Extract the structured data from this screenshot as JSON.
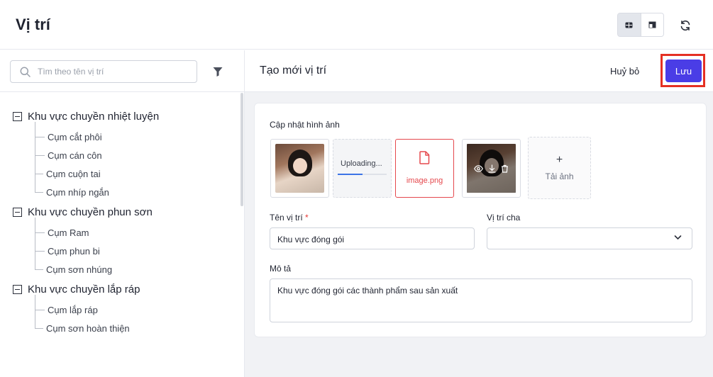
{
  "header": {
    "title": "Vị trí"
  },
  "sidebar": {
    "search_placeholder": "Tìm theo tên vị trí",
    "groups": [
      {
        "label": "Khu vực chuyền nhiệt luyện",
        "items": [
          "Cụm cắt phôi",
          "Cụm cán côn",
          "Cụm cuộn tai",
          "Cụm nhíp ngắn"
        ]
      },
      {
        "label": "Khu vực chuyền phun sơn",
        "items": [
          "Cụm Ram",
          "Cụm phun bi",
          "Cụm sơn nhúng"
        ]
      },
      {
        "label": "Khu vực chuyền lắp ráp",
        "items": [
          "Cụm lắp ráp",
          "Cụm sơn hoàn thiện"
        ]
      }
    ]
  },
  "main": {
    "title": "Tạo mới vị trí",
    "cancel_label": "Huỷ bỏ",
    "save_label": "Lưu",
    "image_section_label": "Cập nhật hình ảnh",
    "uploading_text": "Uploading...",
    "upload_progress": 0.5,
    "error_file_name": "image.png",
    "add_image_label": "Tải ảnh",
    "add_image_symbol": "+",
    "name_label": "Tên vị trí",
    "name_required_mark": "*",
    "name_value": "Khu vực đóng gói",
    "parent_label": "Vị trí cha",
    "parent_value": "",
    "description_label": "Mô tả",
    "description_value": "Khu vực đóng gói các thành phẩm sau sản xuất"
  },
  "colors": {
    "primary": "#4a3de6",
    "highlight": "#e53023",
    "error": "#e5484d"
  }
}
